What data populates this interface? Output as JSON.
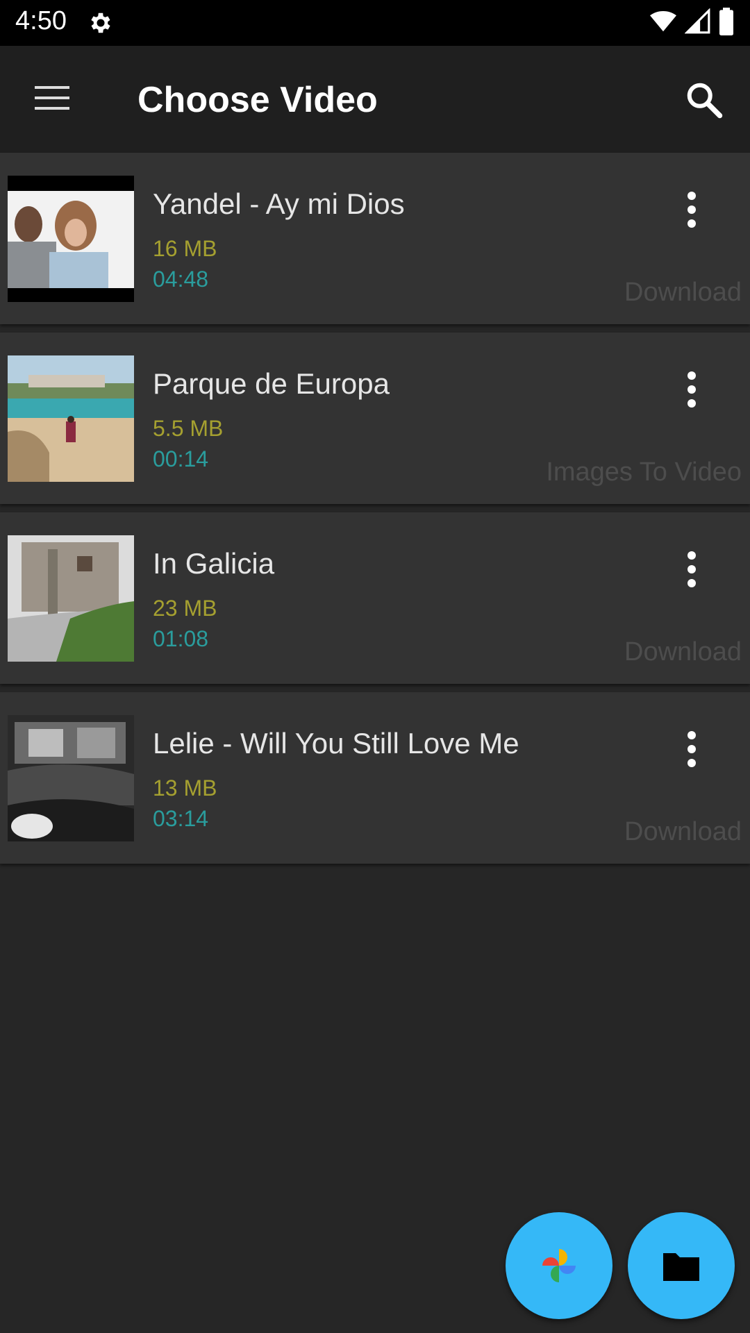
{
  "status_bar": {
    "time": "4:50",
    "icons": [
      "gear-icon",
      "wifi-icon",
      "signal-icon",
      "battery-icon"
    ]
  },
  "app_bar": {
    "title": "Choose Video",
    "menu_icon": "menu-icon",
    "search_icon": "search-icon"
  },
  "videos": [
    {
      "title": "Yandel - Ay mi Dios",
      "size": "16 MB",
      "duration": "04:48",
      "tag": "Download"
    },
    {
      "title": "Parque de Europa",
      "size": "5.5 MB",
      "duration": "00:14",
      "tag": "Images To Video"
    },
    {
      "title": "In Galicia",
      "size": "23 MB",
      "duration": "01:08",
      "tag": "Download"
    },
    {
      "title": "Lelie - Will You Still Love Me",
      "size": "13 MB",
      "duration": "03:14",
      "tag": "Download"
    }
  ],
  "fabs": [
    {
      "icon": "google-photos-icon"
    },
    {
      "icon": "folder-icon"
    }
  ],
  "colors": {
    "accent": "#35b8f7",
    "size_text": "#a5a030",
    "duration_text": "#2a9d9d",
    "tag_text": "#4d4d4d"
  }
}
